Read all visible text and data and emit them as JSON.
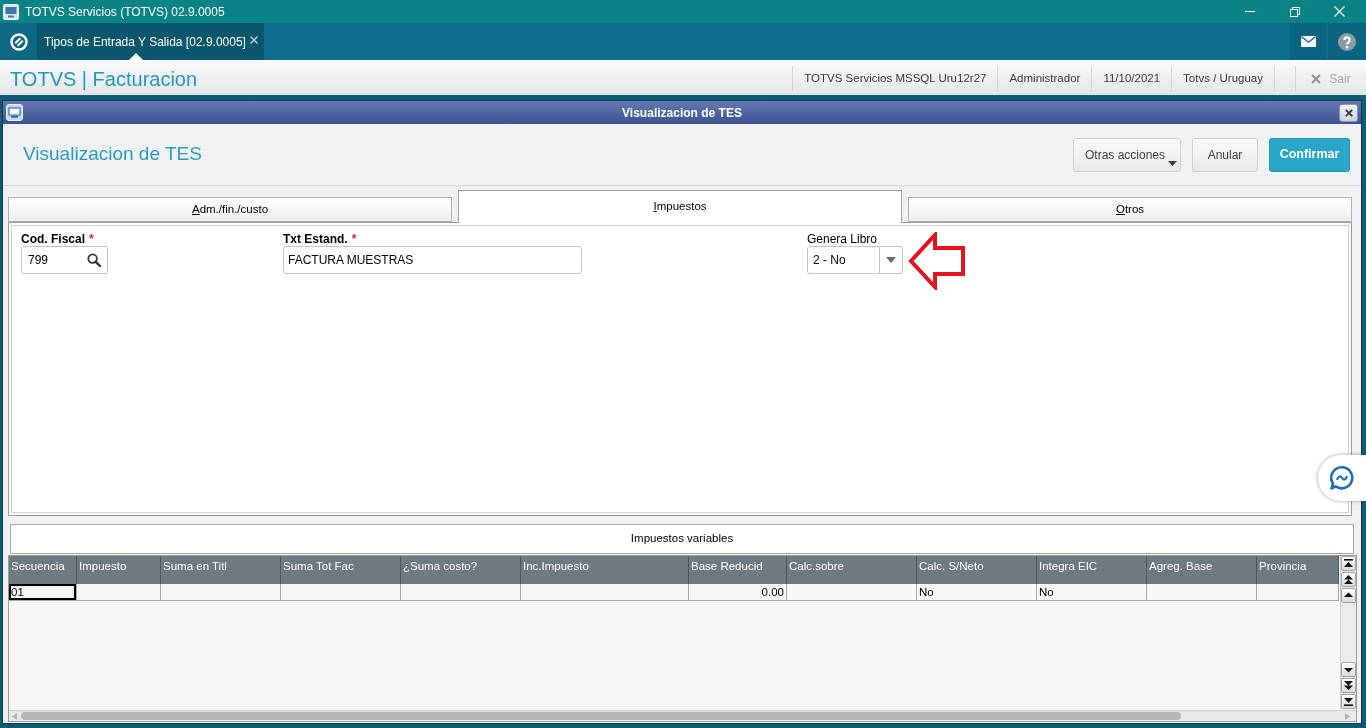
{
  "window": {
    "title": "TOTVS Servicios (TOTVS) 02.9.0005"
  },
  "app_tabs": [
    {
      "label": "Tipos de Entrada Y Salida [02.9.0005]",
      "selected": true
    }
  ],
  "header": {
    "title": "TOTVS | Facturacion",
    "info": [
      "TOTVS Servicios MSSQL Uru12r27",
      "Administrador",
      "11/10/2021",
      "Totvs / Uruguay"
    ],
    "exit": {
      "label": "Sair",
      "disabled": true
    }
  },
  "dialog": {
    "title": "Visualizacion de TES",
    "heading": "Visualizacion de TES",
    "buttons": [
      {
        "label": "Otras acciones",
        "kind": "menu"
      },
      {
        "label": "Anular",
        "kind": "secondary"
      },
      {
        "label": "Confirmar",
        "kind": "primary"
      }
    ],
    "tabs": [
      {
        "label": "Adm./fin./custo",
        "selected": false
      },
      {
        "label": "Impuestos",
        "selected": true
      },
      {
        "label": "Otros",
        "selected": false
      }
    ],
    "fields": [
      {
        "label": "Cod. Fiscal",
        "required_mark": "*",
        "value": "799",
        "kind": "lookup"
      },
      {
        "label": "Txt Estand.",
        "required_mark": "*",
        "value": "FACTURA MUESTRAS",
        "kind": "text"
      },
      {
        "label": "Genera Libro",
        "value": "2 - No",
        "kind": "select"
      }
    ],
    "grid": {
      "title": "Impuestos variables",
      "columns": [
        {
          "label": "Secuencia",
          "kind": "text"
        },
        {
          "label": "Impuesto",
          "kind": "text"
        },
        {
          "label": "Suma en Titl",
          "kind": "text"
        },
        {
          "label": "Suma Tot Fac",
          "kind": "text"
        },
        {
          "label": "¿Suma costo?",
          "kind": "text"
        },
        {
          "label": "Inc.Impuesto",
          "kind": "text"
        },
        {
          "label": "Base Reducid",
          "kind": "number"
        },
        {
          "label": "Calc.sobre",
          "kind": "text"
        },
        {
          "label": "Calc. S/Neto",
          "kind": "text"
        },
        {
          "label": "Integra EIC",
          "kind": "text"
        },
        {
          "label": "Agreg. Base",
          "kind": "text"
        },
        {
          "label": "Provincia",
          "kind": "text"
        }
      ],
      "rows": [
        {
          "cells": [
            {
              "text": "01",
              "selected": true
            },
            {
              "selected": false
            },
            {
              "selected": false
            },
            {
              "selected": false
            },
            {
              "selected": false
            },
            {
              "selected": false
            },
            {
              "text": "0.00",
              "selected": false
            },
            {
              "selected": false
            },
            {
              "text": "No",
              "selected": false
            },
            {
              "text": "No",
              "selected": false
            },
            {
              "selected": false
            },
            {
              "selected": false
            }
          ]
        }
      ]
    }
  }
}
